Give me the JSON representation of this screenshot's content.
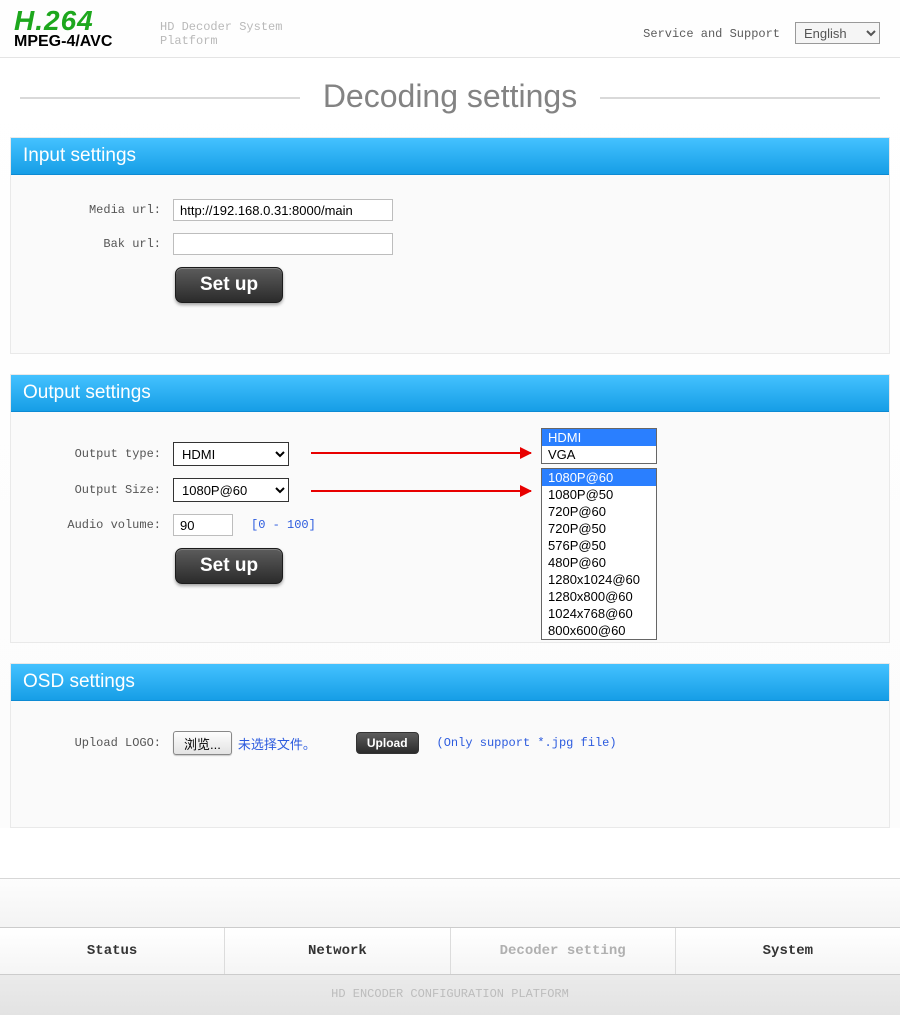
{
  "header": {
    "logo_line1": "H.264",
    "logo_line2": "MPEG-4/AVC",
    "subtitle": "HD Decoder System\nPlatform",
    "service_link": "Service and Support",
    "language": "English"
  },
  "page_title": "Decoding  settings",
  "input_panel": {
    "title": "Input settings",
    "media_url_label": "Media url:",
    "media_url_value": "http://192.168.0.31:8000/main",
    "bak_url_label": "Bak url:",
    "bak_url_value": "",
    "setup_label": "Set up"
  },
  "output_panel": {
    "title": "Output settings",
    "output_type_label": "Output type:",
    "output_type_value": "HDMI",
    "output_type_options": [
      "HDMI",
      "VGA"
    ],
    "output_size_label": "Output Size:",
    "output_size_value": "1080P@60",
    "output_size_options": [
      "1080P@60",
      "1080P@50",
      "720P@60",
      "720P@50",
      "576P@50",
      "480P@60",
      "1280x1024@60",
      "1280x800@60",
      "1024x768@60",
      "800x600@60"
    ],
    "audio_volume_label": "Audio volume:",
    "audio_volume_value": "90",
    "audio_volume_hint": "[0 - 100]",
    "setup_label": "Set up"
  },
  "osd_panel": {
    "title": "OSD settings",
    "upload_logo_label": "Upload LOGO:",
    "browse_label": "浏览...",
    "file_status": "未选择文件。",
    "upload_label": "Upload",
    "hint": "(Only support *.jpg file)"
  },
  "tabs": {
    "status": "Status",
    "network": "Network",
    "decoder": "Decoder setting",
    "system": "System"
  },
  "footer": "HD ENCODER CONFIGURATION PLATFORM"
}
